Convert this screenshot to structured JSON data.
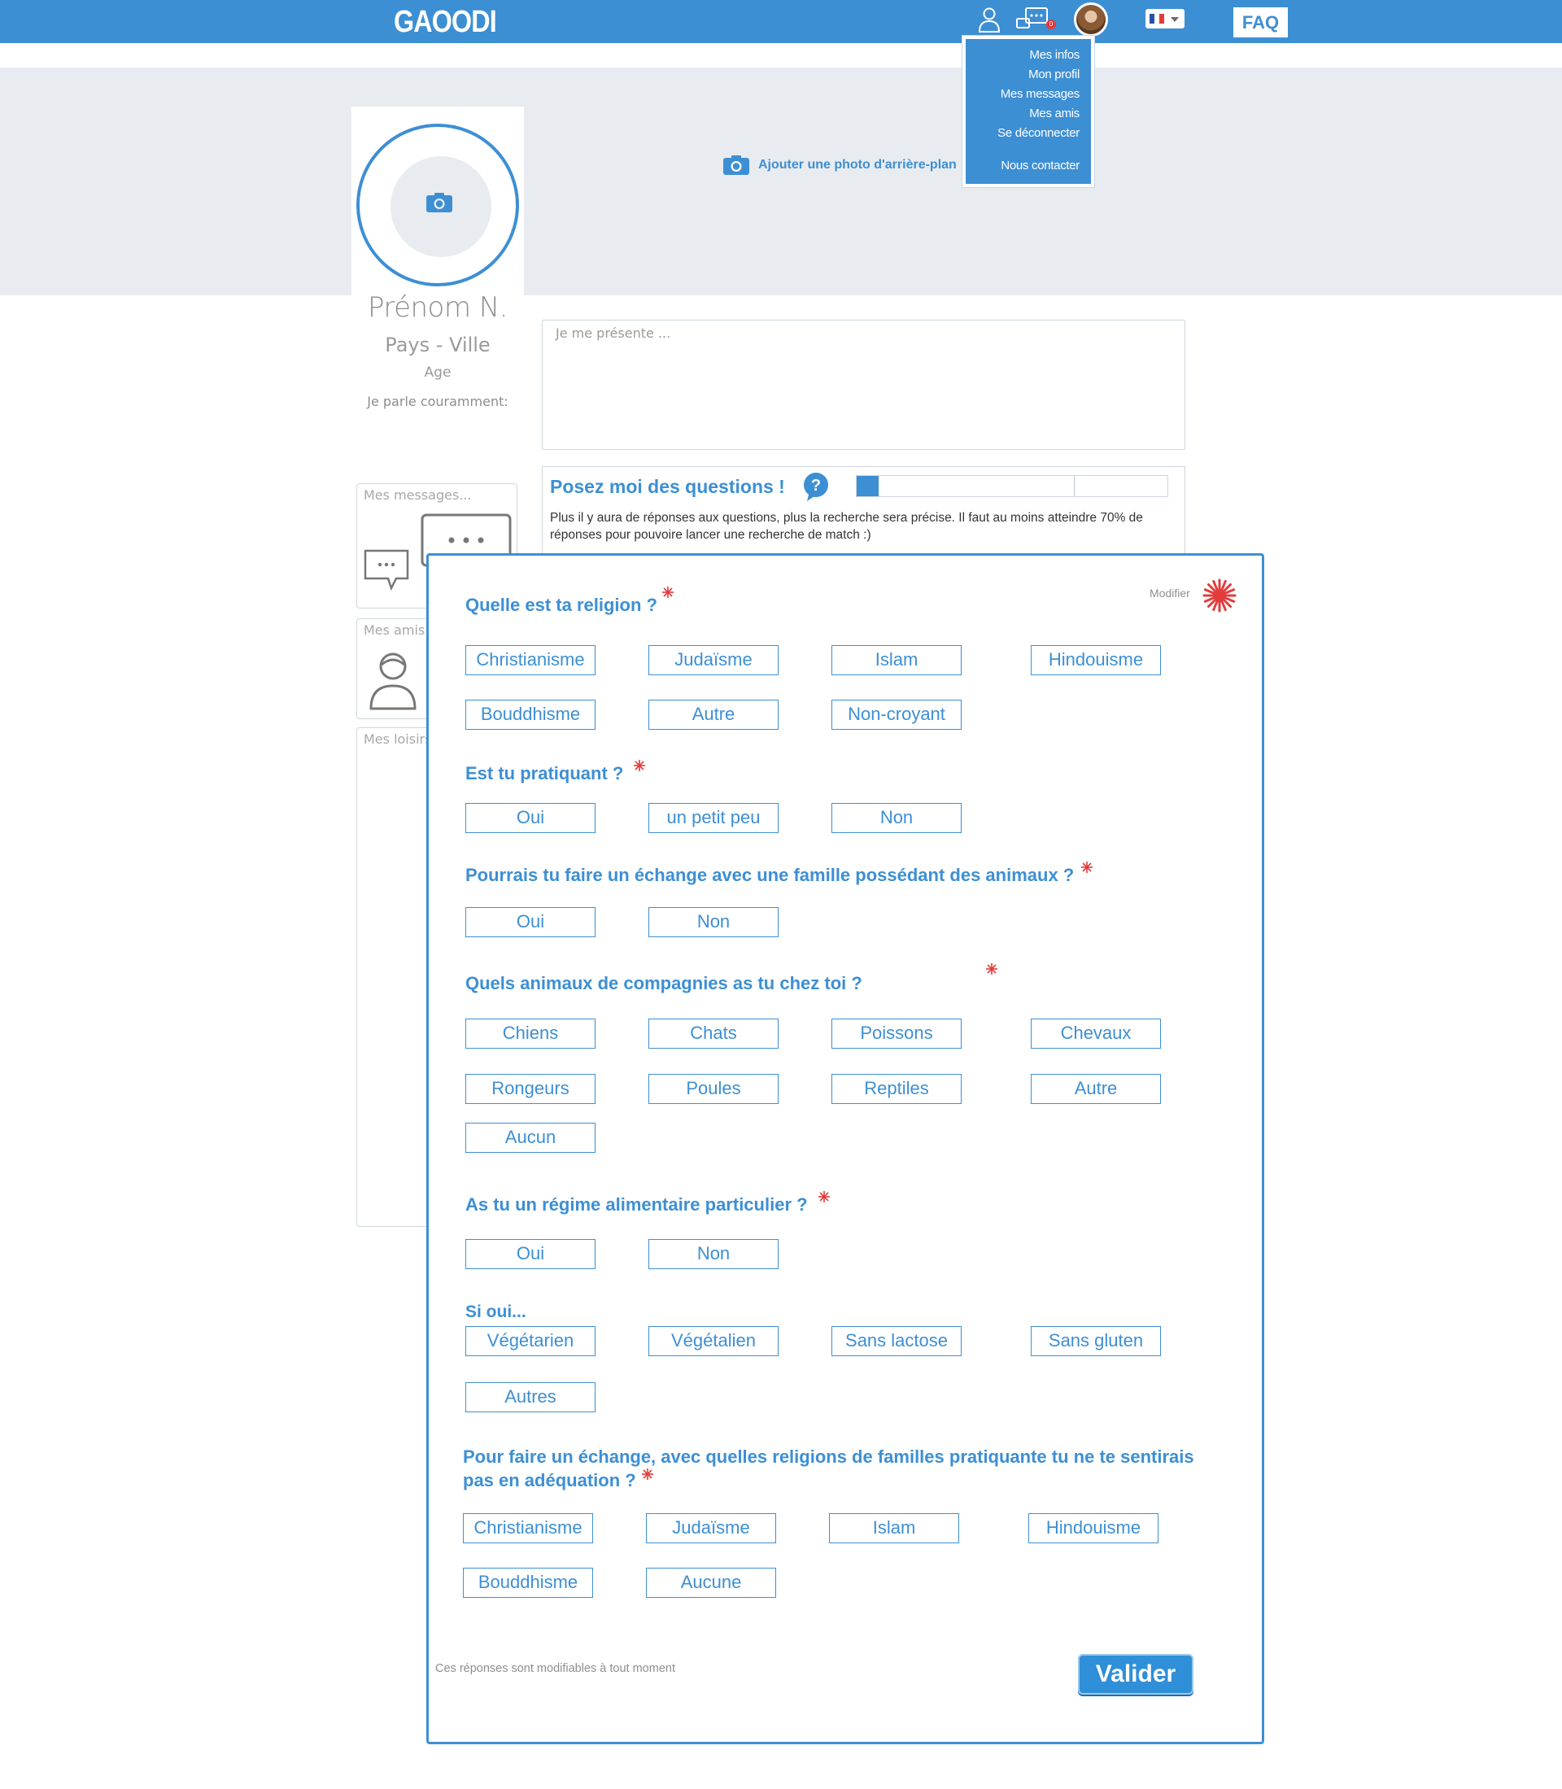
{
  "header": {
    "logo": "GAOODI",
    "faq": "FAQ",
    "message_badge": "0",
    "user_menu": [
      "Mes infos",
      "Mon profil",
      "Mes messages",
      "Mes amis",
      "Se déconnecter",
      "Nous contacter"
    ]
  },
  "banner": {
    "add_background_photo": "Ajouter une photo d'arrière-plan"
  },
  "profile": {
    "name": "Prénom N.",
    "location": "Pays - Ville",
    "age": "Age",
    "languages": "Je parle couramment:",
    "presentation_placeholder": "Je me présente ..."
  },
  "questions_intro": {
    "title": "Posez moi des questions !",
    "text": "Plus il y aura de réponses aux questions, plus la recherche sera précise. Il faut au moins atteindre 70% de réponses pour pouvoire lancer une recherche de match :)",
    "progress": 0.07,
    "threshold": 0.7
  },
  "side": {
    "messages": "Mes messages...",
    "friends": "Mes amis",
    "hobbies": "Mes loisirs"
  },
  "modal": {
    "modifier": "Modifier",
    "questions": [
      {
        "title": "Quelle est ta religion ?",
        "options": [
          "Christianisme",
          "Judaïsme",
          "Islam",
          "Hindouisme",
          "Bouddhisme",
          "Autre",
          "Non-croyant"
        ]
      },
      {
        "title": "Est tu  pratiquant ?",
        "options": [
          "Oui",
          "un petit peu",
          "Non"
        ]
      },
      {
        "title": "Pourrais tu faire un échange avec une famille possédant des animaux ?",
        "options": [
          "Oui",
          "Non"
        ]
      },
      {
        "title": "Quels animaux de compagnies as tu chez toi ?",
        "options": [
          "Chiens",
          "Chats",
          "Poissons",
          "Chevaux",
          "Rongeurs",
          "Poules",
          "Reptiles",
          "Autre",
          "Aucun"
        ]
      },
      {
        "title": "As tu un régime alimentaire particulier ?",
        "options": [
          "Oui",
          "Non"
        ],
        "sub_label": "Si oui...",
        "sub_options": [
          "Végétarien",
          "Végétalien",
          "Sans lactose",
          "Sans gluten",
          "Autres"
        ]
      },
      {
        "title": "Pour faire un échange, avec quelles religions de familles pratiquante tu ne te sentirais pas en adéquation ?",
        "options": [
          "Christianisme",
          "Judaïsme",
          "Islam",
          "Hindouisme",
          "Bouddhisme",
          "Aucune"
        ]
      }
    ],
    "footnote": "Ces réponses sont modifiables à tout moment",
    "submit": "Valider"
  },
  "colors": {
    "primary": "#3d8fd4",
    "banner": "#e8ecf0",
    "required_star": "#e33b3b"
  },
  "icons": [
    "user-icon",
    "message-icon",
    "camera-icon",
    "question-icon",
    "chat-icon",
    "friend-icon",
    "required-star-icon"
  ]
}
